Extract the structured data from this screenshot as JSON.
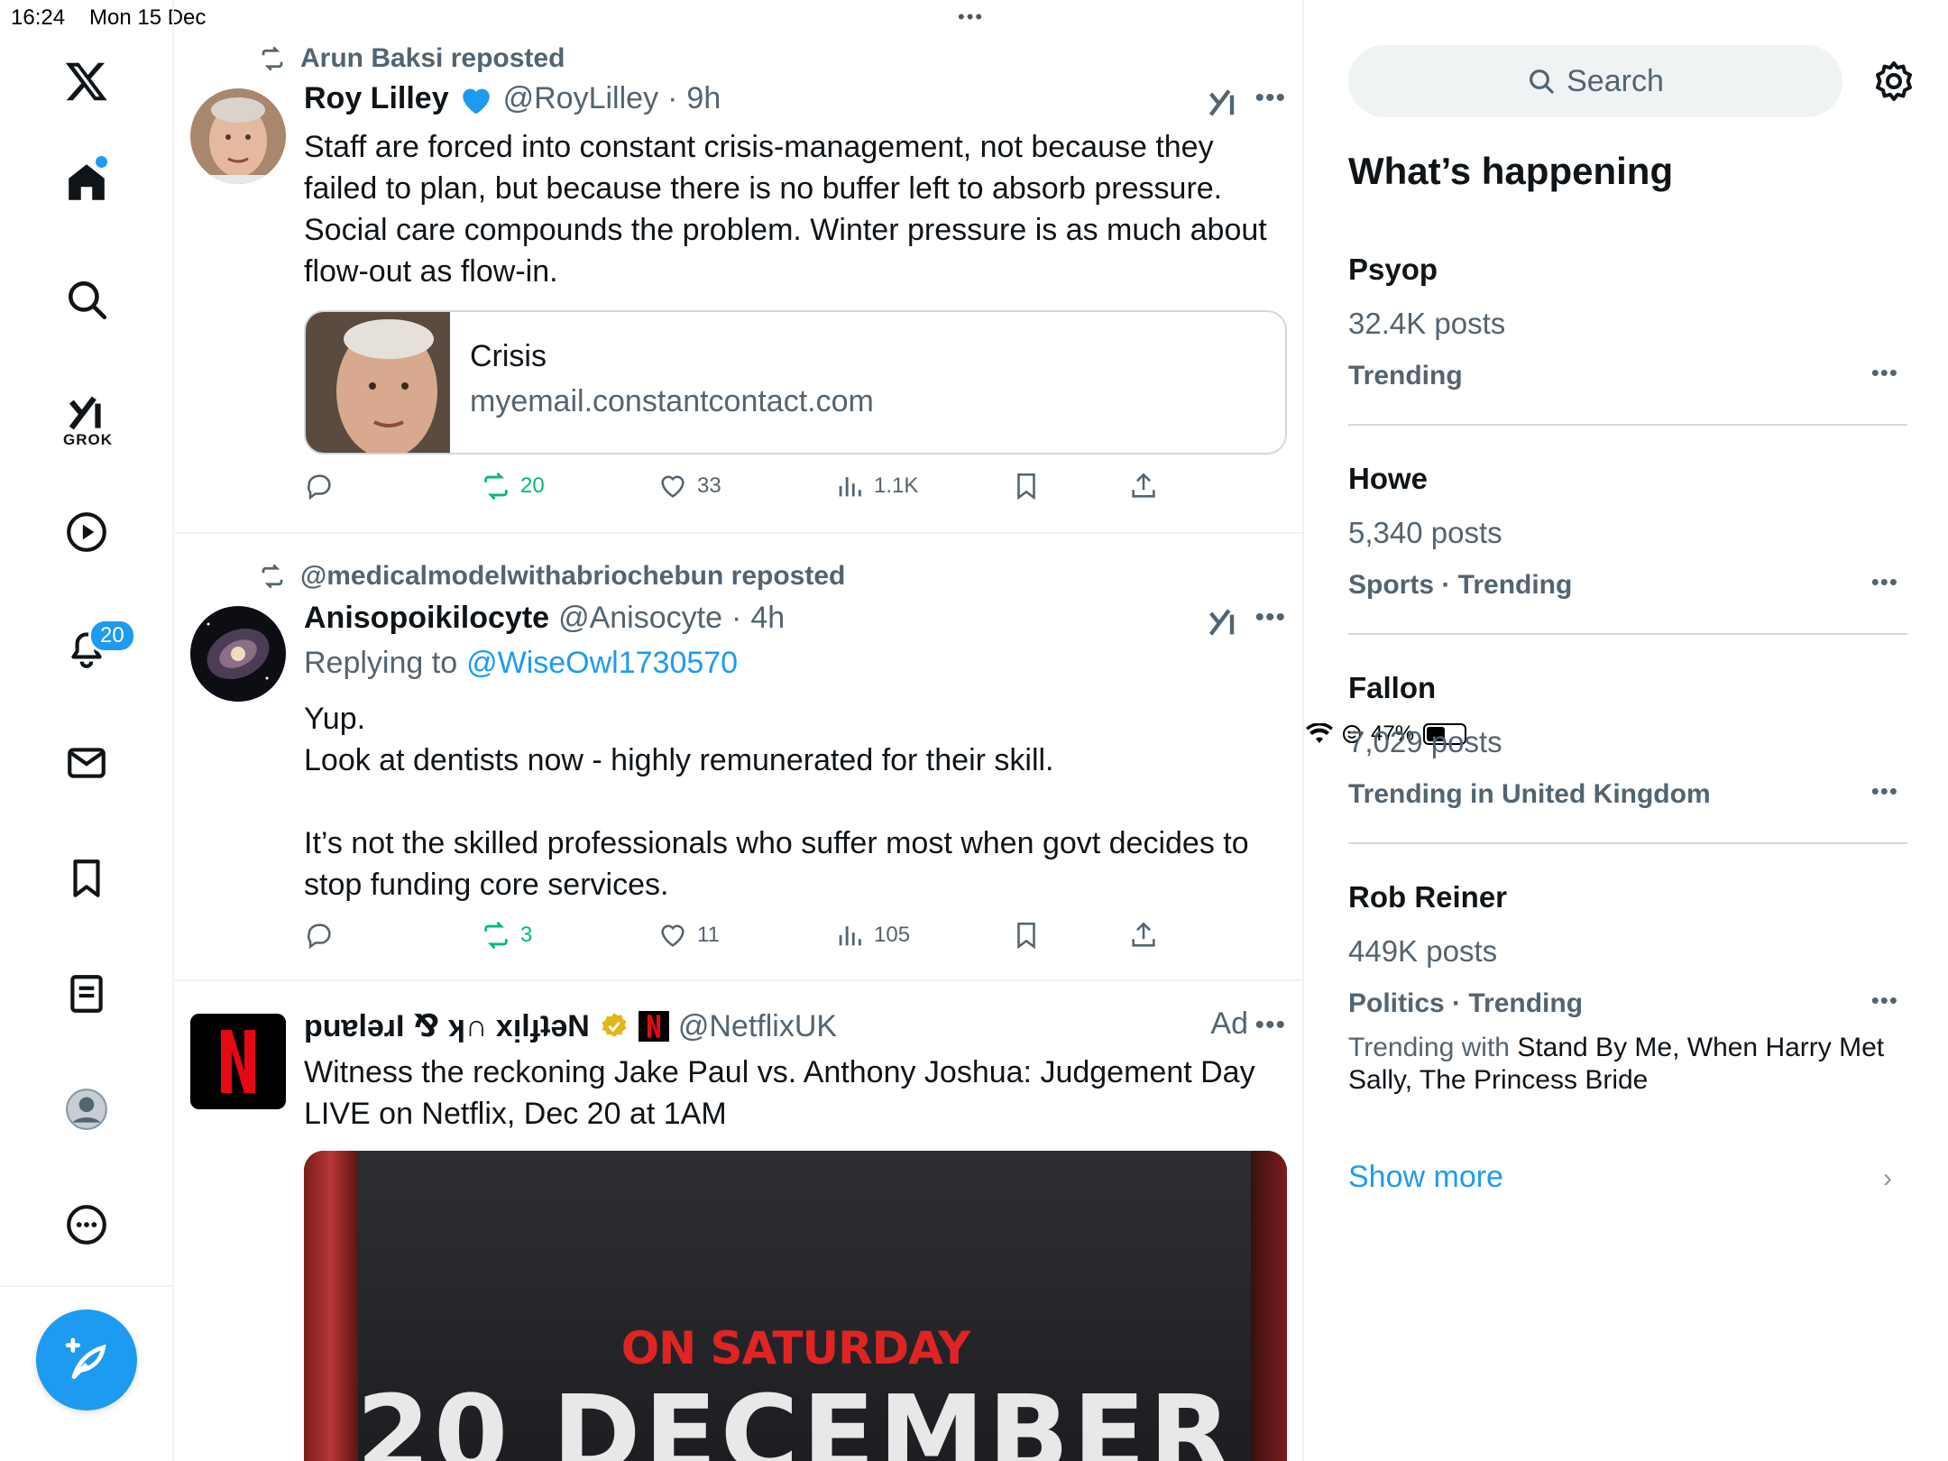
{
  "status": {
    "time": "16:24",
    "date": "Mon 15 Dec",
    "battery": "47%"
  },
  "nav": {
    "grok_label": "GROK",
    "notifications_badge": "20"
  },
  "feed": {
    "post1": {
      "reposted_by": "Arun Baksi reposted",
      "name": "Roy Lilley",
      "handle": "@RoyLilley",
      "time": "9h",
      "text": "Staff are forced into constant crisis-management, not because they failed to plan, but because there is no buffer left to absorb pressure. Social care compounds the problem. Winter pressure is as much about flow-out as flow-in.",
      "card_title": "Crisis",
      "card_domain": "myemail.constantcontact.com",
      "retweets": "20",
      "likes": "33",
      "views": "1.1K"
    },
    "post2": {
      "reposted_by": "@medicalmodelwithabriochebun reposted",
      "name": "Anisopoikilocyte",
      "handle": "@Anisocyte",
      "time": "4h",
      "replying_label": "Replying to",
      "replying_to": "@WiseOwl1730570",
      "text": "Yup.\nLook at dentists now - highly remunerated for their skill.\n\nIt’s not the skilled professionals who suffer most when govt decides to stop funding core services.",
      "retweets": "3",
      "likes": "11",
      "views": "105"
    },
    "post3": {
      "name": "puɐlǝɹI ⅋ ʞ∩ xᴉlɟʇǝN",
      "handle": "@NetflixUK",
      "ad_label": "Ad",
      "text": "Witness the reckoning Jake Paul vs. Anthony Joshua: Judgement Day LIVE on Netflix, Dec 20 at 1AM",
      "media_line1": "ON SATURDAY",
      "media_line2": "20 DECEMBER"
    }
  },
  "sidebar": {
    "search_placeholder": "Search",
    "heading": "What’s happening",
    "trends": [
      {
        "name": "Psyop",
        "count": "32.4K posts",
        "category": "Trending"
      },
      {
        "name": "Howe",
        "count": "5,340 posts",
        "category": "Sports · Trending"
      },
      {
        "name": "Fallon",
        "count": "7,029 posts",
        "category": "Trending in United Kingdom"
      },
      {
        "name": "Rob Reiner",
        "count": "449K posts",
        "category": "Politics · Trending",
        "with_label": "Trending with",
        "with_terms": "Stand By Me, When Harry Met Sally, The Princess Bride"
      }
    ],
    "show_more": "Show more"
  },
  "colors": {
    "accent": "#1d9bf0",
    "retweet_green": "#00ba7c",
    "muted": "#536471"
  }
}
